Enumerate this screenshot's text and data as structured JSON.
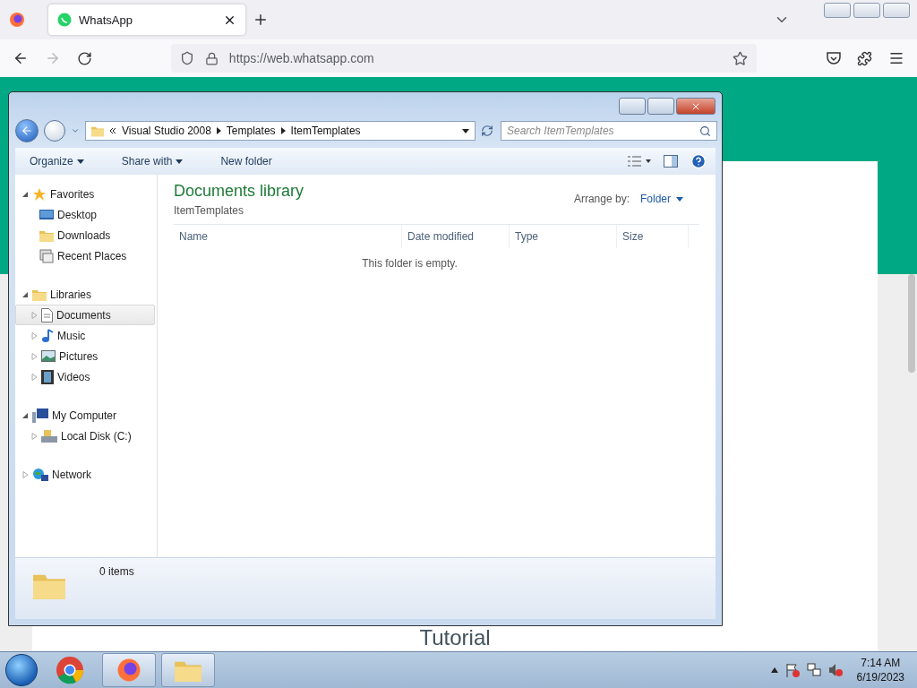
{
  "browser": {
    "tab": {
      "title": "WhatsApp",
      "selected": true
    },
    "url": "https://web.whatsapp.com"
  },
  "page": {
    "heading": "Tutorial"
  },
  "explorer": {
    "breadcrumb": [
      "Visual Studio 2008",
      "Templates",
      "ItemTemplates"
    ],
    "search": {
      "placeholder": "Search ItemTemplates"
    },
    "toolbar": [
      {
        "label": "Organize",
        "kind": "menu"
      },
      {
        "label": "Share with",
        "kind": "menu"
      },
      {
        "label": "New folder",
        "kind": "button"
      }
    ],
    "nav": [
      {
        "label": "Favorites",
        "expanded": true,
        "children": [
          {
            "label": "Desktop",
            "selected": false
          },
          {
            "label": "Downloads",
            "selected": false
          },
          {
            "label": "Recent Places",
            "selected": false
          }
        ]
      },
      {
        "label": "Libraries",
        "expanded": true,
        "children": [
          {
            "label": "Documents",
            "selected": true,
            "expanded": false
          },
          {
            "label": "Music",
            "selected": false,
            "expanded": false
          },
          {
            "label": "Pictures",
            "selected": false,
            "expanded": false
          },
          {
            "label": "Videos",
            "selected": false,
            "expanded": false
          }
        ]
      },
      {
        "label": "My Computer",
        "expanded": true,
        "children": [
          {
            "label": "Local Disk (C:)",
            "selected": false,
            "expanded": false
          }
        ]
      },
      {
        "label": "Network",
        "expanded": false
      }
    ],
    "library": {
      "title": "Documents library",
      "subtitle": "ItemTemplates",
      "arrange_label": "Arrange by:",
      "arrange_value": "Folder"
    },
    "columns": [
      "Name",
      "Date modified",
      "Type",
      "Size"
    ],
    "empty_message": "This folder is empty.",
    "status": "0 items"
  },
  "taskbar": {
    "time": "7:14 AM",
    "date": "6/19/2023"
  }
}
